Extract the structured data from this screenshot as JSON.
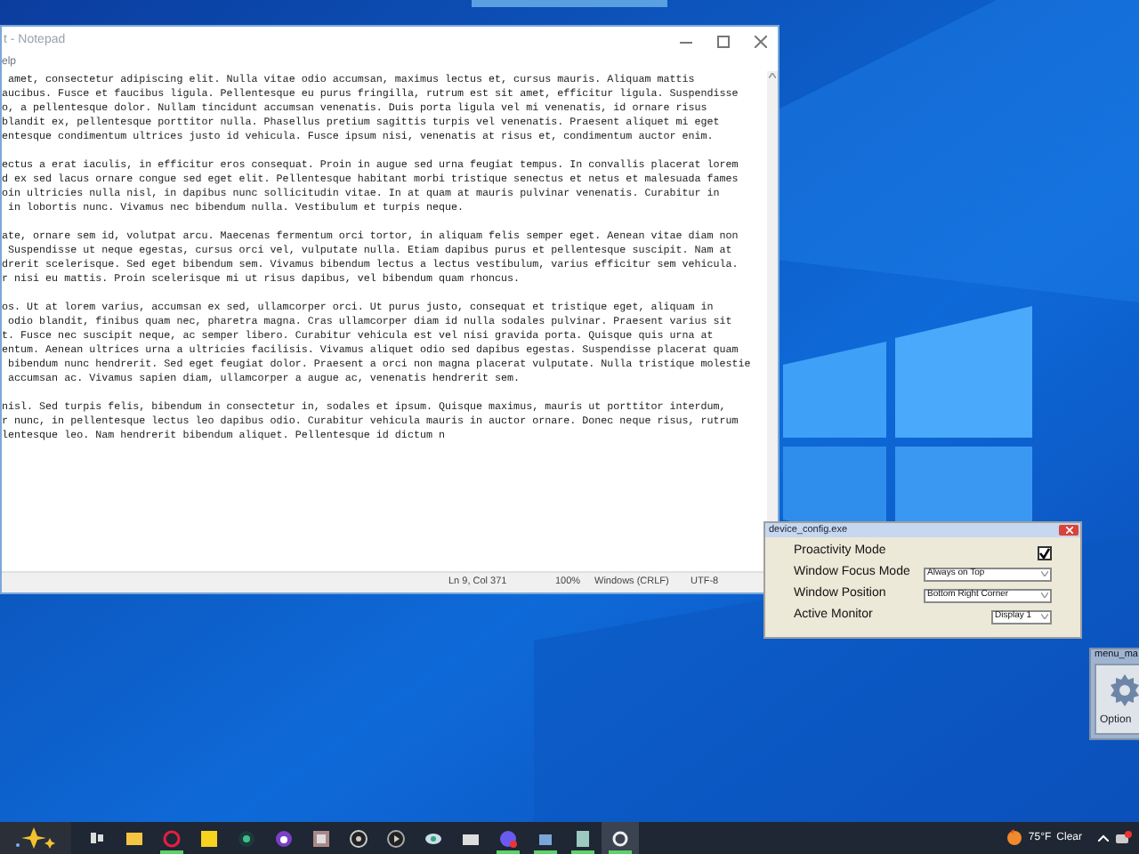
{
  "notepad": {
    "title": "t - Notepad",
    "menu": [
      "elp"
    ],
    "paragraphs": [
      [
        " amet, consectetur adipiscing elit. Nulla vitae odio accumsan, maximus lectus et, cursus mauris. Aliquam mattis",
        "aucibus. Fusce et faucibus ligula. Pellentesque eu purus fringilla, rutrum est sit amet, efficitur ligula. Suspendisse",
        "o, a pellentesque dolor. Nullam tincidunt accumsan venenatis. Duis porta ligula vel mi venenatis, id ornare risus",
        "blandit ex, pellentesque porttitor nulla. Phasellus pretium sagittis turpis vel venenatis. Praesent aliquet mi eget",
        "entesque condimentum ultrices justo id vehicula. Fusce ipsum nisi, venenatis at risus et, condimentum auctor enim."
      ],
      [
        "ectus a erat iaculis, in efficitur eros consequat. Proin in augue sed urna feugiat tempus. In convallis placerat lorem",
        "d ex sed lacus ornare congue sed eget elit. Pellentesque habitant morbi tristique senectus et netus et malesuada fames",
        "oin ultricies nulla nisl, in dapibus nunc sollicitudin vitae. In at quam at mauris pulvinar venenatis. Curabitur in",
        " in lobortis nunc. Vivamus nec bibendum nulla. Vestibulum et turpis neque."
      ],
      [
        "ate, ornare sem id, volutpat arcu. Maecenas fermentum orci tortor, in aliquam felis semper eget. Aenean vitae diam non",
        " Suspendisse ut neque egestas, cursus orci vel, vulputate nulla. Etiam dapibus purus et pellentesque suscipit. Nam at",
        "drerit scelerisque. Sed eget bibendum sem. Vivamus bibendum lectus a lectus vestibulum, varius efficitur sem vehicula.",
        "r nisi eu mattis. Proin scelerisque mi ut risus dapibus, vel bibendum quam rhoncus."
      ],
      [
        "os. Ut at lorem varius, accumsan ex sed, ullamcorper orci. Ut purus justo, consequat et tristique eget, aliquam in",
        " odio blandit, finibus quam nec, pharetra magna. Cras ullamcorper diam id nulla sodales pulvinar. Praesent varius sit",
        "t. Fusce nec suscipit neque, ac semper libero. Curabitur vehicula est vel nisi gravida porta. Quisque quis urna at",
        "entum. Aenean ultrices urna a ultricies facilisis. Vivamus aliquet odio sed dapibus egestas. Suspendisse placerat quam",
        " bibendum nunc hendrerit. Sed eget feugiat dolor. Praesent a orci non magna placerat vulputate. Nulla tristique molestie",
        " accumsan ac. Vivamus sapien diam, ullamcorper a augue ac, venenatis hendrerit sem."
      ],
      [
        "nisl. Sed turpis felis, bibendum in consectetur in, sodales et ipsum. Quisque maximus, mauris ut porttitor interdum,",
        "r nunc, in pellentesque lectus leo dapibus odio. Curabitur vehicula mauris in auctor ornare. Donec neque risus, rutrum",
        "lentesque leo. Nam hendrerit bibendum aliquet. Pellentesque id dictum n"
      ]
    ],
    "status_bar": [
      "Ln 9, Col 371",
      "100%",
      "Windows (CRLF)",
      "UTF-8"
    ]
  },
  "config_window": {
    "title": "device_config.exe",
    "rows": [
      {
        "kind": "checkbox",
        "label": "Proactivity Mode",
        "checked": true
      },
      {
        "kind": "dropdown",
        "label": "Window Focus Mode",
        "value": "Always on Top"
      },
      {
        "kind": "dropdown",
        "label": "Window Position",
        "value": "Bottom Right Corner"
      },
      {
        "kind": "dropdown",
        "label": "Active Monitor",
        "value": "Display 1"
      }
    ]
  },
  "menu_window": {
    "title": "menu_ma",
    "button": "Option"
  },
  "taskbar": {
    "apps": [
      {
        "running": false,
        "active": false
      },
      {
        "running": false,
        "active": false
      },
      {
        "running": true,
        "active": false
      },
      {
        "running": false,
        "active": false
      },
      {
        "running": false,
        "active": false
      },
      {
        "running": false,
        "active": false
      },
      {
        "running": false,
        "active": false
      },
      {
        "running": false,
        "active": false
      },
      {
        "running": false,
        "active": false
      },
      {
        "running": false,
        "active": false
      },
      {
        "running": false,
        "active": false
      },
      {
        "running": true,
        "active": false
      },
      {
        "running": true,
        "active": false
      },
      {
        "running": true,
        "active": false
      },
      {
        "running": true,
        "active": true
      }
    ],
    "weather": {
      "temperature": "75°F",
      "condition": "Clear"
    }
  }
}
